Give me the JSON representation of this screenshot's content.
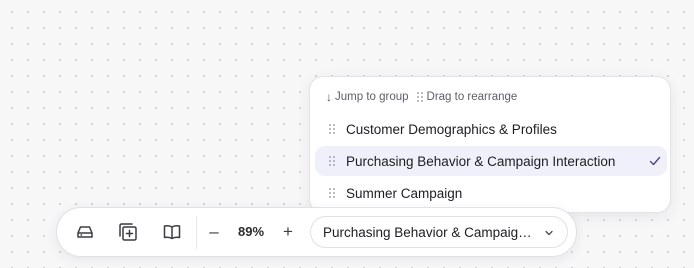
{
  "dropdown": {
    "hint_jump": "Jump to group",
    "hint_drag": "Drag to rearrange",
    "items": [
      {
        "label": "Customer Demographics & Profiles",
        "selected": false
      },
      {
        "label": "Purchasing Behavior & Campaign Interaction",
        "selected": true
      },
      {
        "label": "Summer Campaign",
        "selected": false
      }
    ]
  },
  "toolbar": {
    "icons": [
      "drive-icon",
      "add-frame-icon",
      "book-icon"
    ],
    "zoom_value": "89%",
    "zoom_minus": "–",
    "zoom_plus": "+",
    "current_group": "Purchasing Behavior & Campaign Interaction"
  },
  "colors": {
    "selected_bg": "#f0f0fb",
    "canvas_bg": "#f7f7f8",
    "dot": "#d2d2d8"
  }
}
